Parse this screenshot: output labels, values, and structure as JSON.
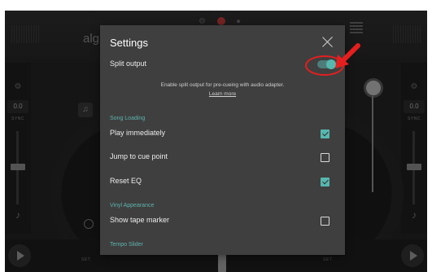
{
  "background_app": {
    "logo_partial": "alg",
    "left_deck": {
      "value": "0.0",
      "sync": "SYNC",
      "set": "SET"
    },
    "right_deck": {
      "value": "0.0",
      "sync": "SYNC",
      "set": "SET"
    }
  },
  "dialog": {
    "title": "Settings",
    "split_output": {
      "label": "Split output",
      "enabled": true,
      "info": "Enable split output for pre-cueing with audio adapter.",
      "learn_more": "Learn more"
    },
    "sections": [
      {
        "header": "Song Loading",
        "items": [
          {
            "label": "Play immediately",
            "checked": true
          },
          {
            "label": "Jump to cue point",
            "checked": false
          },
          {
            "label": "Reset EQ",
            "checked": true
          }
        ]
      },
      {
        "header": "Vinyl Appearance",
        "items": [
          {
            "label": "Show tape marker",
            "checked": false
          }
        ]
      },
      {
        "header": "Tempo Slider",
        "items": []
      }
    ]
  },
  "colors": {
    "accent": "#57b7ae",
    "dialog_bg": "#3f3f3f",
    "annotation": "#e41f1f"
  },
  "icons": {
    "close": "close-icon",
    "toggle": "toggle-switch",
    "checkbox": "checkbox-icon",
    "annotation_arrow": "arrow-icon"
  }
}
